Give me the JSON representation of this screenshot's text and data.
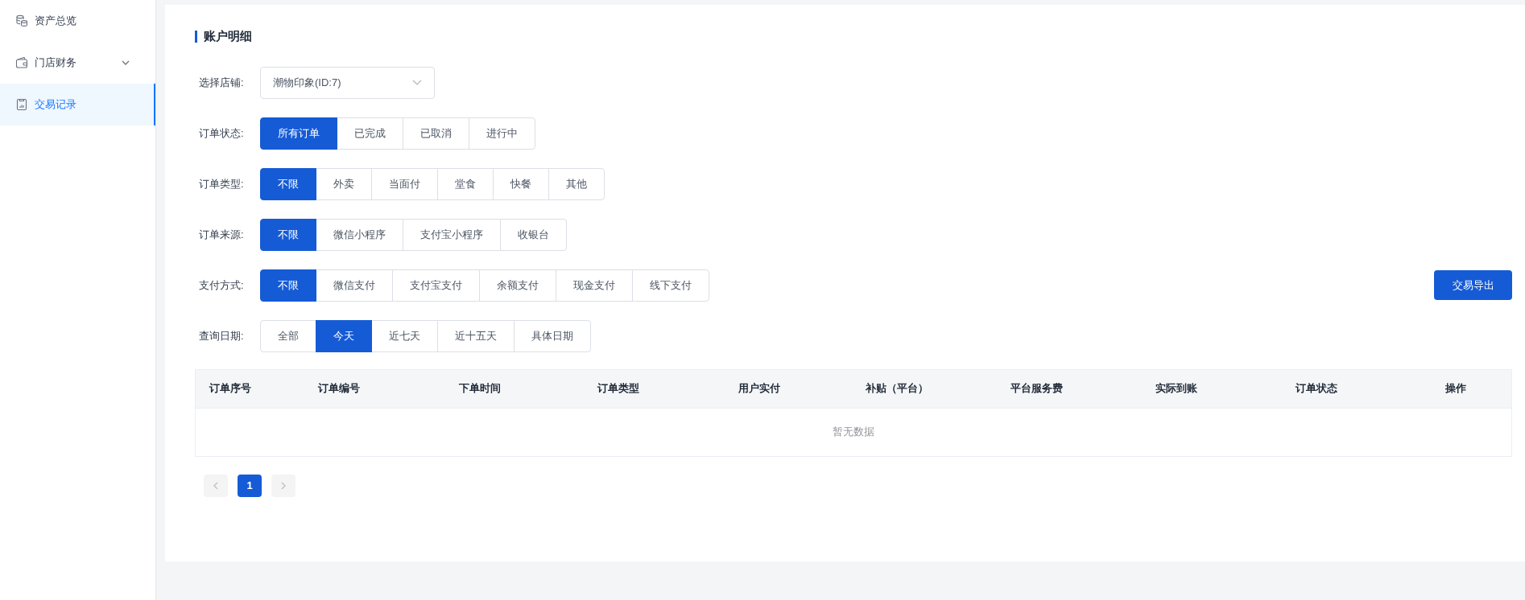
{
  "sidebar": {
    "items": [
      {
        "label": "资产总览",
        "kind": "link",
        "selected": false
      },
      {
        "label": "门店财务",
        "kind": "group",
        "expanded": false,
        "selected": false
      },
      {
        "label": "交易记录",
        "kind": "link",
        "selected": true
      }
    ]
  },
  "panel": {
    "title": "账户明细",
    "store_select": {
      "label": "选择店铺:",
      "value": "潮物印象(ID:7)"
    },
    "filters": [
      {
        "label": "订单状态:",
        "options": [
          {
            "label": "所有订单",
            "selected": true
          },
          {
            "label": "已完成",
            "selected": false
          },
          {
            "label": "已取消",
            "selected": false
          },
          {
            "label": "进行中",
            "selected": false
          }
        ]
      },
      {
        "label": "订单类型:",
        "options": [
          {
            "label": "不限",
            "selected": true
          },
          {
            "label": "外卖",
            "selected": false
          },
          {
            "label": "当面付",
            "selected": false
          },
          {
            "label": "堂食",
            "selected": false
          },
          {
            "label": "快餐",
            "selected": false
          },
          {
            "label": "其他",
            "selected": false
          }
        ]
      },
      {
        "label": "订单来源:",
        "options": [
          {
            "label": "不限",
            "selected": true
          },
          {
            "label": "微信小程序",
            "selected": false
          },
          {
            "label": "支付宝小程序",
            "selected": false
          },
          {
            "label": "收银台",
            "selected": false
          }
        ]
      },
      {
        "label": "支付方式:",
        "options": [
          {
            "label": "不限",
            "selected": true
          },
          {
            "label": "微信支付",
            "selected": false
          },
          {
            "label": "支付宝支付",
            "selected": false
          },
          {
            "label": "余额支付",
            "selected": false
          },
          {
            "label": "现金支付",
            "selected": false
          },
          {
            "label": "线下支付",
            "selected": false
          }
        ]
      },
      {
        "label": "查询日期:",
        "options": [
          {
            "label": "全部",
            "selected": false
          },
          {
            "label": "今天",
            "selected": true
          },
          {
            "label": "近七天",
            "selected": false
          },
          {
            "label": "近十五天",
            "selected": false
          },
          {
            "label": "具体日期",
            "selected": false
          }
        ]
      }
    ],
    "export_button": "交易导出",
    "table": {
      "columns": [
        "订单序号",
        "订单编号",
        "下单时间",
        "订单类型",
        "用户实付",
        "补贴（平台）",
        "平台服务费",
        "实际到账",
        "订单状态",
        "操作"
      ],
      "empty_text": "暂无数据"
    },
    "pagination": {
      "pages": [
        {
          "label": "1",
          "selected": true
        }
      ]
    }
  }
}
